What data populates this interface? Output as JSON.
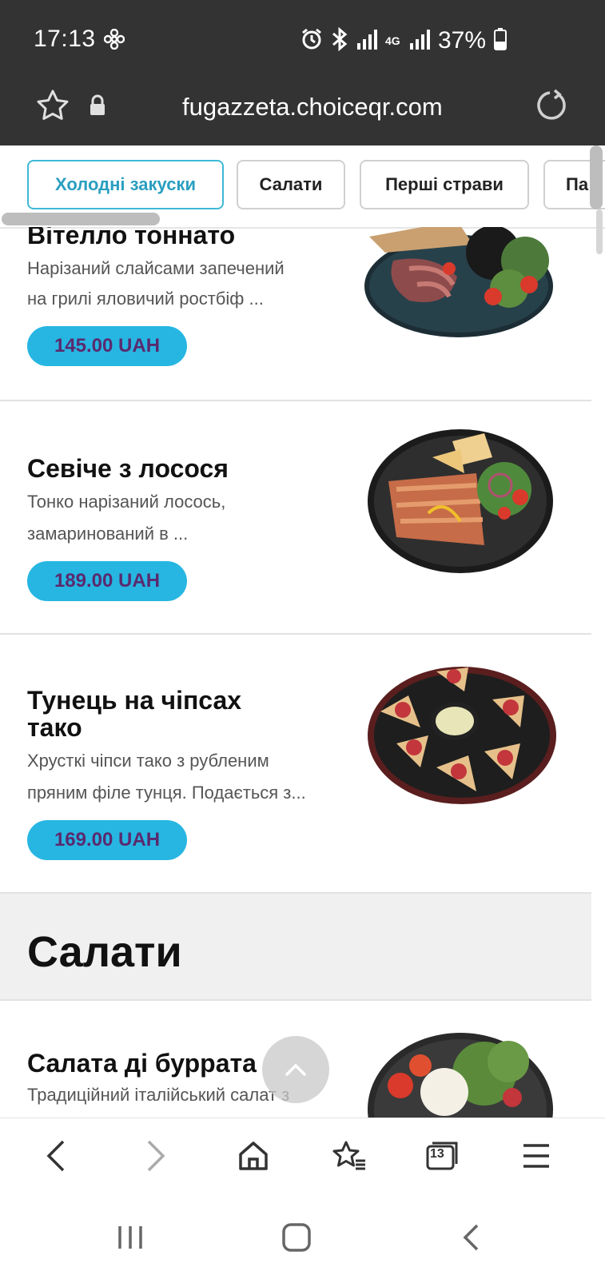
{
  "status_bar": {
    "time": "17:13",
    "network": "4G",
    "battery": "37%"
  },
  "browser": {
    "url": "fugazzeta.choiceqr.com",
    "open_tabs": "13"
  },
  "category_tabs": [
    {
      "label": "Холодні закуски",
      "active": true
    },
    {
      "label": "Салати",
      "active": false
    },
    {
      "label": "Перші страви",
      "active": false
    },
    {
      "label": "Па",
      "active": false
    }
  ],
  "menu_items": [
    {
      "title": "Вітелло тоннато",
      "description_line1": "Нарізаний слайсами запечений",
      "description_line2": "на грилі яловичий ростбіф ...",
      "price": "145.00 UAH"
    },
    {
      "title": "Севіче з лосося",
      "description_line1": "Тонко нарізаний лосось,",
      "description_line2": "замаринований в ...",
      "price": "189.00 UAH"
    },
    {
      "title_line1": "Тунець на чіпсах",
      "title_line2": "тако",
      "description_line1": "Хрусткі чіпси тако з рубленим",
      "description_line2": "пряним філе тунця. Подається з...",
      "price": "169.00 UAH"
    }
  ],
  "section": {
    "title": "Салати"
  },
  "next_item": {
    "title": "Салата ді буррата",
    "description_partial": "Традиційний італійський салат з"
  },
  "colors": {
    "accent": "#27b6e2",
    "price_text": "#5a2a6e",
    "active_tab": "#3fb8d6",
    "topbar": "#333333"
  }
}
